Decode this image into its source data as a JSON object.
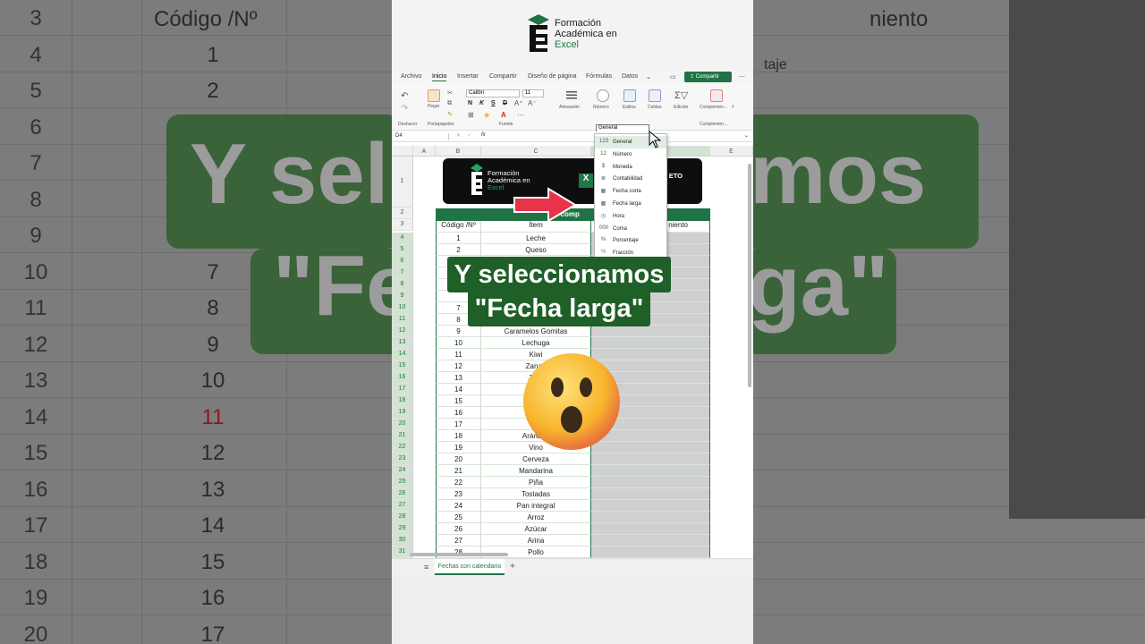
{
  "background": {
    "row_numbers": [
      "3",
      "4",
      "5",
      "6",
      "7",
      "8",
      "9",
      "10",
      "11",
      "12",
      "13",
      "14",
      "15",
      "16",
      "17",
      "18",
      "19",
      "20"
    ],
    "col_b_header": "Código /Nº",
    "col_b_values": [
      "1",
      "2",
      "",
      "",
      "",
      "",
      "7",
      "8",
      "9",
      "10",
      "11",
      "12",
      "13",
      "14",
      "15",
      "16",
      "17"
    ],
    "right_header": "niento",
    "right_small": [
      "taje"
    ],
    "big_text_line1": "Y sel",
    "big_text_line2": "\"Fe",
    "big_text_right1": "mos",
    "big_text_right2": "ga\"",
    "row_number_color_red": "11"
  },
  "logo": {
    "line1": "Formación",
    "line2": "Académica en",
    "line3": "Excel"
  },
  "menu_tabs": [
    "Archivo",
    "Inicio",
    "Insertar",
    "Compartir",
    "Diseño de página",
    "Fórmulas",
    "Datos"
  ],
  "share_label": "Compartir",
  "ribbon": {
    "undo_label": "Deshacer",
    "paste_label": "Pegar",
    "clipboard_label": "Portapapeles",
    "font_name": "Calibri",
    "font_size": "11",
    "font_group_label": "Fuente",
    "align_label": "Alineación",
    "number_label": "Número",
    "styles_label": "Estilos",
    "cells_label": "Celdas",
    "edit_label": "Edición",
    "addins_label": "Complemen...",
    "addins_group_label": "Complemen...",
    "bold": "N",
    "italic": "K",
    "underline": "S",
    "strike": "D"
  },
  "formula_bar": {
    "name_box": "D4",
    "fx": "fx"
  },
  "number_format_box": "General",
  "dropdown_items": [
    {
      "icon": "123",
      "label": "General"
    },
    {
      "icon": "12",
      "label": "Número"
    },
    {
      "icon": "$",
      "label": "Moneda"
    },
    {
      "icon": "≣",
      "label": "Contabilidad"
    },
    {
      "icon": "▦",
      "label": "Fecha corta"
    },
    {
      "icon": "▦",
      "label": "Fecha larga"
    },
    {
      "icon": "◷",
      "label": "Hora"
    },
    {
      "icon": "000",
      "label": "Coma"
    },
    {
      "icon": "%",
      "label": "Porcentaje"
    },
    {
      "icon": "½",
      "label": "Fracción"
    }
  ],
  "grid": {
    "columns": [
      "A",
      "B",
      "C",
      "D",
      "E"
    ],
    "banner_text_left_l1": "Formación",
    "banner_text_left_l2": "Académica en",
    "banner_text_left_l3": "Excel",
    "banner_text_right": "ETO",
    "banner_x": "X",
    "green_header_text": "de comp",
    "header_b": "Código /Nº",
    "header_c": "Ítem",
    "header_d": "niento",
    "rows": [
      {
        "r": "4",
        "b": "1",
        "c": "Leche"
      },
      {
        "r": "5",
        "b": "2",
        "c": "Queso"
      },
      {
        "r": "6",
        "b": "",
        "c": ""
      },
      {
        "r": "7",
        "b": "",
        "c": ""
      },
      {
        "r": "8",
        "b": "",
        "c": ""
      },
      {
        "r": "9",
        "b": "",
        "c": ""
      },
      {
        "r": "10",
        "b": "7",
        "c": ""
      },
      {
        "r": "11",
        "b": "8",
        "c": ""
      },
      {
        "r": "12",
        "b": "9",
        "c": "Caramelos Gomitas"
      },
      {
        "r": "13",
        "b": "10",
        "c": "Lechuga"
      },
      {
        "r": "14",
        "b": "11",
        "c": "Kiwi"
      },
      {
        "r": "15",
        "b": "12",
        "c": "Zanah"
      },
      {
        "r": "16",
        "b": "13",
        "c": "Jugo"
      },
      {
        "r": "17",
        "b": "14",
        "c": "G"
      },
      {
        "r": "18",
        "b": "15",
        "c": "Ch"
      },
      {
        "r": "19",
        "b": "16",
        "c": "C"
      },
      {
        "r": "20",
        "b": "17",
        "c": "F"
      },
      {
        "r": "21",
        "b": "18",
        "c": "Arándan"
      },
      {
        "r": "22",
        "b": "19",
        "c": "Vino"
      },
      {
        "r": "23",
        "b": "20",
        "c": "Cerveza"
      },
      {
        "r": "24",
        "b": "21",
        "c": "Mandarina"
      },
      {
        "r": "25",
        "b": "22",
        "c": "Piña"
      },
      {
        "r": "26",
        "b": "23",
        "c": "Tostadas"
      },
      {
        "r": "27",
        "b": "24",
        "c": "Pan integral"
      },
      {
        "r": "28",
        "b": "25",
        "c": "Arroz"
      },
      {
        "r": "29",
        "b": "26",
        "c": "Azúcar"
      },
      {
        "r": "30",
        "b": "27",
        "c": "Arina"
      },
      {
        "r": "31",
        "b": "28",
        "c": "Pollo"
      }
    ]
  },
  "caption": {
    "line1": "Y seleccionamos",
    "line2": "\"Fecha larga\""
  },
  "sheet_tab": "Fechas con calendario",
  "colors": {
    "excel_green": "#217346",
    "caption_bg": "#1f5f28",
    "arrow_red": "#e8334a"
  }
}
